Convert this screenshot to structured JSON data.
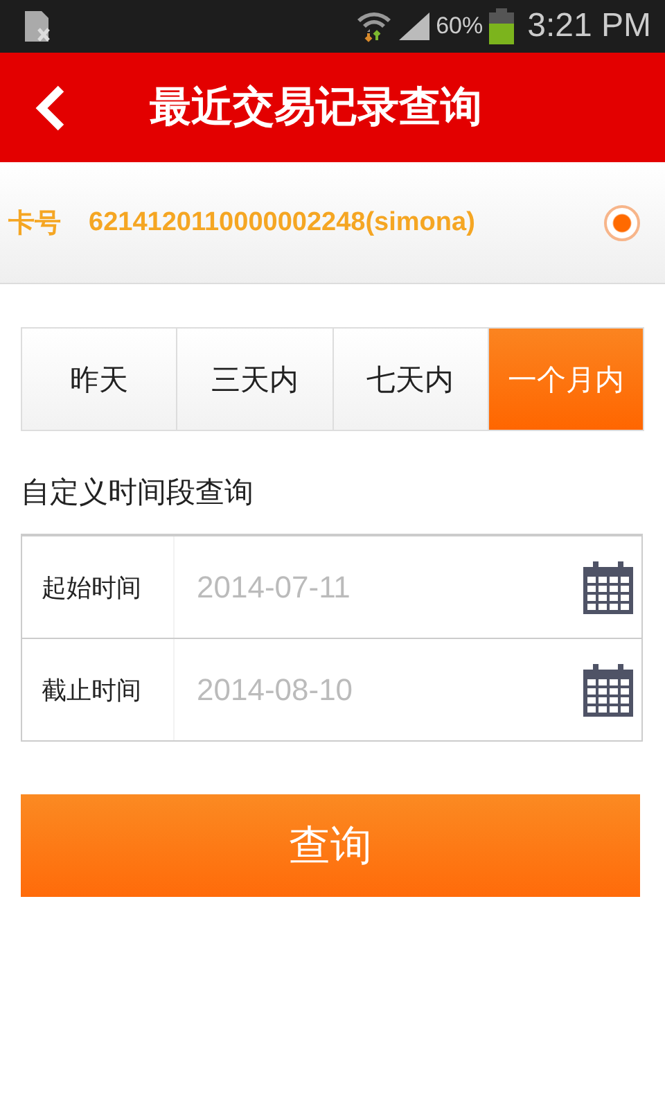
{
  "status_bar": {
    "battery": "60%",
    "time": "3:21 PM"
  },
  "header": {
    "title": "最近交易记录查询"
  },
  "card": {
    "label": "卡号",
    "number": "6214120110000002248(simona)",
    "selected": true
  },
  "ranges": [
    {
      "label": "昨天",
      "selected": false
    },
    {
      "label": "三天内",
      "selected": false
    },
    {
      "label": "七天内",
      "selected": false
    },
    {
      "label": "一个月内",
      "selected": true
    }
  ],
  "custom_title": "自定义时间段查询",
  "fields": [
    {
      "label": "起始时间",
      "placeholder": "2014-07-11"
    },
    {
      "label": "截止时间",
      "placeholder": "2014-08-10"
    }
  ],
  "submit": "查询"
}
